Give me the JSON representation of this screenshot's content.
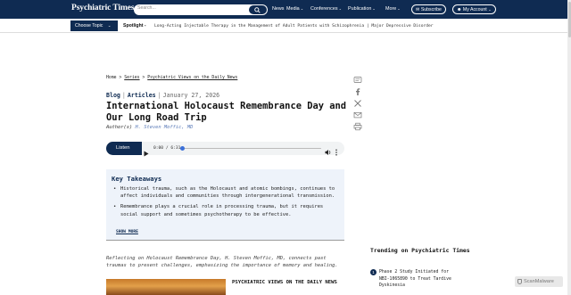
{
  "header": {
    "logo": "Psychiatric Times",
    "search_placeholder": "Search...",
    "nav": [
      {
        "label": "News",
        "has_menu": false
      },
      {
        "label": "Media",
        "has_menu": true
      },
      {
        "label": "Conferences",
        "has_menu": true
      },
      {
        "label": "Publication",
        "has_menu": true
      },
      {
        "label": "More",
        "has_menu": true
      }
    ],
    "subscribe_label": "Subscribe",
    "account_label": "My Account"
  },
  "subbar": {
    "choose_topic": "Choose Topic",
    "spotlight_label": "Spotlight -",
    "spotlight_text": "Long-Acting Injectable Therapy in the Management of Adult Patients with Schizophrenia | Major Depressive Disorder"
  },
  "breadcrumb": {
    "home": "Home",
    "series": "Series",
    "current": "Psychiatric Views on the Daily News"
  },
  "article": {
    "tag1": "Blog",
    "tag2": "Articles",
    "date": "January 27, 2026",
    "title": "International Holocaust Remembrance Day and Our Long Road Trip",
    "authors_label": "Author(s)",
    "author": "H. Steven Moffic, MD",
    "lead": "Reflecting on Holocaust Remembrance Day, H. Steven Moffic, MD, connects past traumas to present challenges, emphasizing the importance of memory and healing.",
    "series_heading": "PSYCHIATRIC VIEWS ON THE DAILY NEWS"
  },
  "audio": {
    "listen_label": "Listen",
    "time": "0:00 / 6:31",
    "progress": 0
  },
  "takeaways": {
    "title": "Key Takeaways",
    "items": [
      "Historical trauma, such as the Holocaust and atomic bombings, continues to affect individuals and communities through intergenerational transmission.",
      "Remembrance plays a crucial role in processing trauma, but it requires social support and sometimes psychotherapy to be effective."
    ],
    "show_more": "SHOW MORE"
  },
  "sidebar": {
    "trending_title": "Trending on Psychiatric Times",
    "items": [
      {
        "rank": "1",
        "text": "Phase 2 Study Initiated for NBI-1065890 to Treat Tardive Dyskinesia"
      }
    ]
  },
  "share_icons": [
    "comment-icon",
    "facebook-icon",
    "x-icon",
    "email-icon",
    "print-icon"
  ],
  "badge": "ScanMalware",
  "colors": {
    "brand_navy": "#0f2b52",
    "author_link": "#5b7bb8",
    "takeaways_bg": "#eef3fa"
  }
}
